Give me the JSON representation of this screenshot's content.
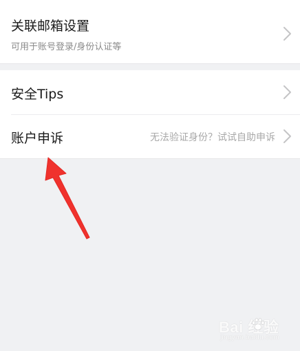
{
  "settings": {
    "linked_email": {
      "title": "关联邮箱设置",
      "subtitle": "可用于账号登录/身份认证等"
    },
    "security_tips": {
      "title": "安全Tips"
    },
    "account_appeal": {
      "title": "账户申诉",
      "hint": "无法验证身份？试试自助申诉"
    }
  },
  "icons": {
    "chevron": "chevron-right-icon",
    "annotation": "red-arrow-icon"
  },
  "colors": {
    "annotation_arrow": "#f0322d",
    "background": "#f0f1f3",
    "row": "#ffffff"
  },
  "watermark": {
    "text": "Bai 经验",
    "sub": "jingyan.baidu.com"
  }
}
